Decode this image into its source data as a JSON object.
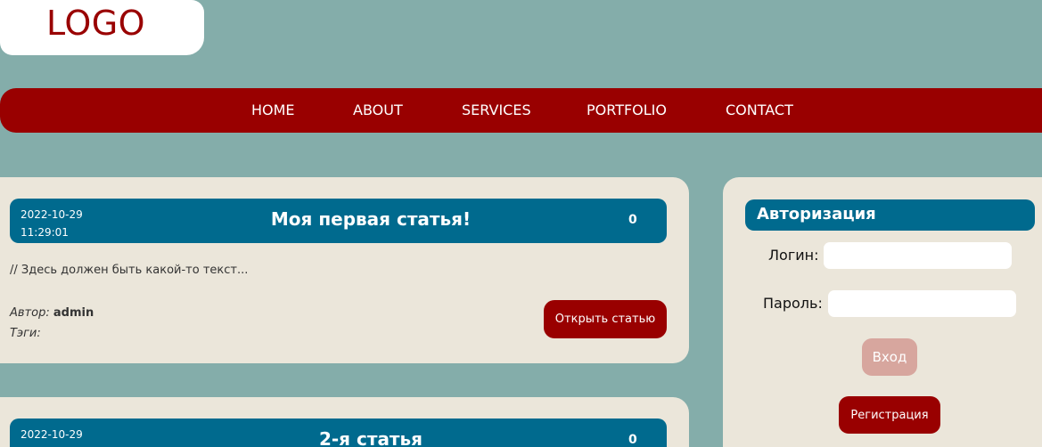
{
  "logo": {
    "text": "LOGO"
  },
  "nav": {
    "items": [
      {
        "label": "HOME"
      },
      {
        "label": "ABOUT"
      },
      {
        "label": "SERVICES"
      },
      {
        "label": "PORTFOLIO"
      },
      {
        "label": "CONTACT"
      }
    ]
  },
  "articles": [
    {
      "date": "2022-10-29",
      "time": "11:29:01",
      "title": "Моя первая статья!",
      "count": "0",
      "excerpt": "// Здесь должен быть какой-то текст...",
      "author_label": "Автор:",
      "author": "admin",
      "tags_label": "Тэги:",
      "tags": "",
      "open_label": "Открыть статью"
    },
    {
      "date": "2022-10-29",
      "title": "2-я статья",
      "count": "0"
    }
  ],
  "auth": {
    "title": "Авторизация",
    "login_label": "Логин:",
    "login_value": "",
    "password_label": "Пароль:",
    "password_value": "",
    "login_button": "Вход",
    "register_button": "Регистрация"
  },
  "colors": {
    "background": "#84adaa",
    "accent_red": "#990000",
    "header_blue": "#006a8e",
    "card_bg": "#ebe6da",
    "disabled_button": "#d7a69e"
  }
}
